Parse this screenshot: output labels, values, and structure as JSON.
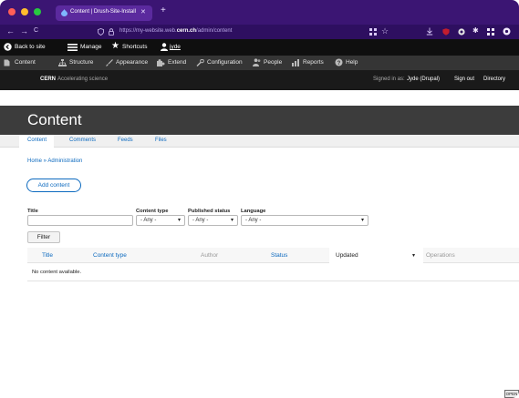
{
  "browser": {
    "tab_title": "Content | Drush-Site-Install",
    "tab_close": "✕",
    "new_tab": "+",
    "nav_back": "←",
    "nav_forward": "→",
    "reload": "C",
    "url_prefix": "https://my-website.web.",
    "url_domain": "cern.ch",
    "url_path": "/admin/content"
  },
  "toolbar": {
    "back_to_site": "Back to site",
    "manage": "Manage",
    "shortcuts": "Shortcuts",
    "user": "jyde"
  },
  "admin_menu": {
    "items": [
      "Content",
      "Structure",
      "Appearance",
      "Extend",
      "Configuration",
      "People",
      "Reports",
      "Help"
    ]
  },
  "cern_bar": {
    "brand": "CERN",
    "tagline": "Accelerating science",
    "signed_in_prefix": "Signed in as:",
    "signed_in_user": "Jyde (Drupal)",
    "sign_out": "Sign out",
    "directory": "Directory"
  },
  "page": {
    "title": "Content",
    "tabs": [
      "Content",
      "Comments",
      "Feeds",
      "Files"
    ],
    "breadcrumb": "Home » Administration",
    "add_content": "Add content"
  },
  "filters": {
    "title_label": "Title",
    "title_value": "",
    "content_type_label": "Content type",
    "content_type_value": "- Any -",
    "published_label": "Published status",
    "published_value": "- Any -",
    "language_label": "Language",
    "language_value": "- Any -",
    "filter_button": "Filter"
  },
  "table": {
    "headers": [
      "Title",
      "Content type",
      "Author",
      "Status",
      "Updated",
      "Operations"
    ],
    "sort_indicator": "▾",
    "empty_message": "No content available."
  },
  "badge": "OPEN",
  "colors": {
    "tabbar": "#3b1573",
    "link": "#0d6abf",
    "toolbar": "#0f0f0f"
  }
}
